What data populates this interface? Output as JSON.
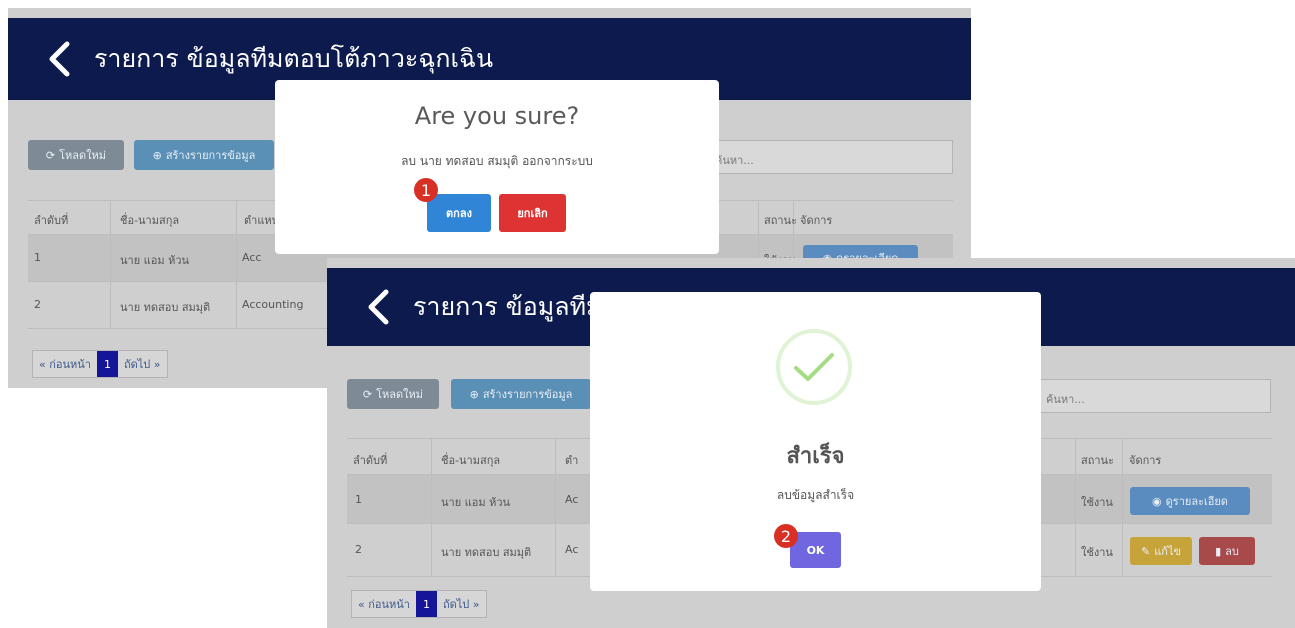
{
  "screens": [
    {
      "header_title": "รายการ ข้อมูลทีมตอบโต้ภาวะฉุกเฉิน",
      "toolbar": {
        "reload_label": "โหลดใหม่",
        "create_label": "สร้างรายการข้อมูล"
      },
      "search": {
        "placeholder": "ค้นหา..."
      },
      "table": {
        "columns": [
          "ลำดับที่",
          "ชื่อ-นามสกุล",
          "ตำแหน่ง",
          "สถานะ",
          "จัดการ"
        ],
        "rows": [
          {
            "no": "1",
            "name": "นาย แอม ห้วน",
            "position": "Acc",
            "status": "ใช้งาน",
            "action": "ดูรายละเอียด"
          },
          {
            "no": "2",
            "name": "นาย ทดสอบ สมมุติ",
            "position": "Accounting",
            "status": "",
            "action": ""
          }
        ]
      },
      "pagination": {
        "prev": "« ก่อนหน้า",
        "current": "1",
        "next": "ถัดไป »"
      },
      "dialog": {
        "title": "Are you sure?",
        "text": "ลบ นาย ทดสอบ สมมุติ ออกจากระบบ",
        "confirm_label": "ตกลง",
        "cancel_label": "ยกเลิก",
        "step_badge": "1",
        "confirm_color": "#3085d6",
        "cancel_color": "#d33"
      }
    },
    {
      "header_title": "รายการ ข้อมูลทีม",
      "toolbar": {
        "reload_label": "โหลดใหม่",
        "create_label": "สร้างรายการข้อมูล"
      },
      "search": {
        "placeholder": "ค้นหา..."
      },
      "table": {
        "columns": [
          "ลำดับที่",
          "ชื่อ-นามสกุล",
          "ตำ",
          "สถานะ",
          "จัดการ"
        ],
        "rows": [
          {
            "no": "1",
            "name": "นาย แอม ห้วน",
            "position": "Ac",
            "status": "ใช้งาน",
            "detail_label": "ดูรายละเอียด"
          },
          {
            "no": "2",
            "name": "นาย ทดสอบ สมมุติ",
            "position": "Ac",
            "status": "ใช้งาน",
            "edit_label": "แก้ไข",
            "delete_label": "ลบ"
          }
        ]
      },
      "pagination": {
        "prev": "« ก่อนหน้า",
        "current": "1",
        "next": "ถัดไป »"
      },
      "dialog": {
        "icon": "success-check-icon",
        "title": "สำเร็จ",
        "text": "ลบข้อมูลสำเร็จ",
        "ok_label": "OK",
        "step_badge": "2",
        "ok_color": "#7066e0"
      }
    }
  ]
}
